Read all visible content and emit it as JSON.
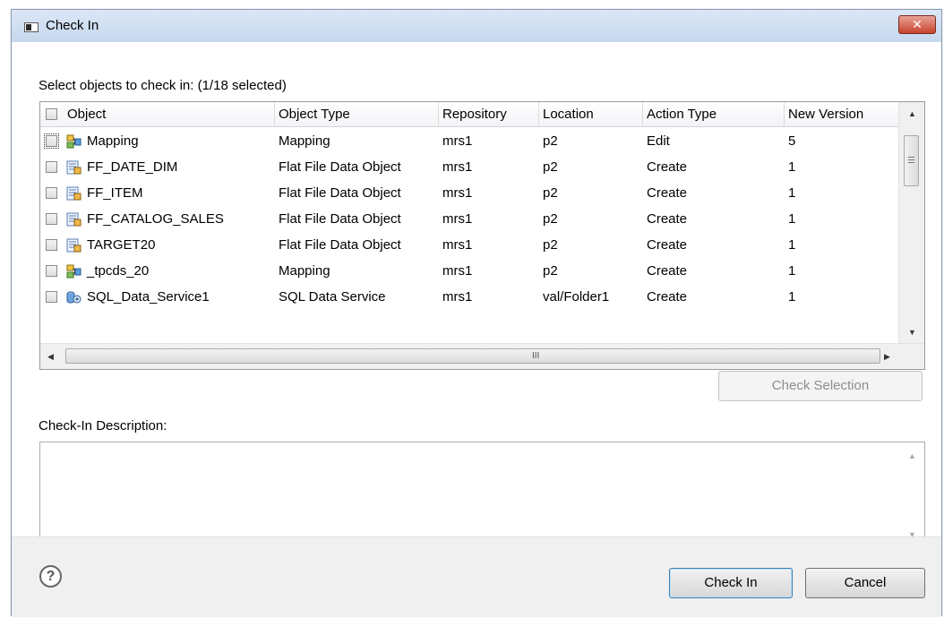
{
  "window": {
    "title": "Check In",
    "close_symbol": "✕"
  },
  "selection_label": "Select objects to check in: (1/18 selected)",
  "table": {
    "headers": [
      "Object",
      "Object Type",
      "Repository",
      "Location",
      "Action Type",
      "New Version"
    ],
    "rows": [
      {
        "icon": "mapping-icon",
        "object": "Mapping",
        "type": "Mapping",
        "repository": "mrs1",
        "location": "p2",
        "action": "Edit",
        "version": "5"
      },
      {
        "icon": "flat-file-icon",
        "object": "FF_DATE_DIM",
        "type": "Flat File Data Object",
        "repository": "mrs1",
        "location": "p2",
        "action": "Create",
        "version": "1"
      },
      {
        "icon": "flat-file-icon",
        "object": "FF_ITEM",
        "type": "Flat File Data Object",
        "repository": "mrs1",
        "location": "p2",
        "action": "Create",
        "version": "1"
      },
      {
        "icon": "flat-file-icon",
        "object": "FF_CATALOG_SALES",
        "type": "Flat File Data Object",
        "repository": "mrs1",
        "location": "p2",
        "action": "Create",
        "version": "1"
      },
      {
        "icon": "flat-file-icon",
        "object": "TARGET20",
        "type": "Flat File Data Object",
        "repository": "mrs1",
        "location": "p2",
        "action": "Create",
        "version": "1"
      },
      {
        "icon": "mapping-icon",
        "object": "_tpcds_20",
        "type": "Mapping",
        "repository": "mrs1",
        "location": "p2",
        "action": "Create",
        "version": "1"
      },
      {
        "icon": "sql-data-service-icon",
        "object": "SQL_Data_Service1",
        "type": "SQL Data Service",
        "repository": "mrs1",
        "location": "val/Folder1",
        "action": "Create",
        "version": "1"
      }
    ],
    "hscroll_grip": "III"
  },
  "buttons": {
    "check_selection": "Check Selection",
    "check_in": "Check In",
    "cancel": "Cancel"
  },
  "description": {
    "label": "Check-In Description:",
    "value": ""
  },
  "help_symbol": "?",
  "colors": {
    "title_bar": "#c6d8ee",
    "close_button": "#c7432d",
    "dialog_bg": "#f0f0f0",
    "default_button_border": "#3c7fb1"
  }
}
